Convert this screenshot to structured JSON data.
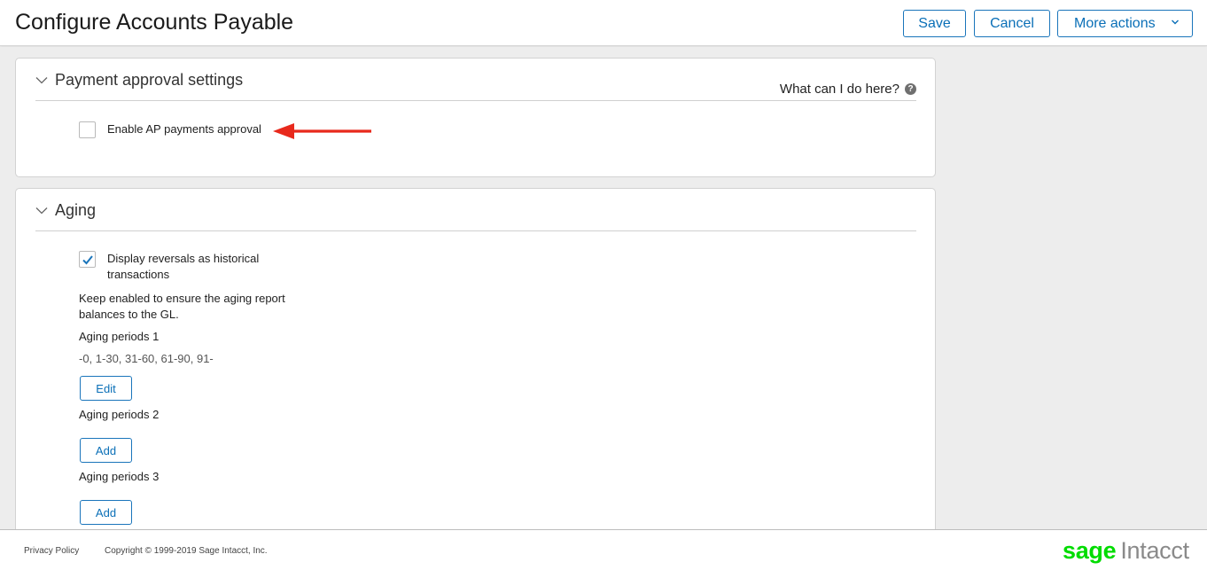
{
  "header": {
    "title": "Configure Accounts Payable",
    "save_label": "Save",
    "cancel_label": "Cancel",
    "more_actions_label": "More actions"
  },
  "payment_approval": {
    "title": "Payment approval settings",
    "help_text": "What can I do here?",
    "enable_ap_label": "Enable AP payments approval",
    "enable_ap_checked": false
  },
  "aging": {
    "title": "Aging",
    "display_reversals_label_line1": "Display reversals as historical",
    "display_reversals_label_line2": "transactions",
    "display_reversals_checked": true,
    "note_line1": "Keep enabled to ensure the aging report",
    "note_line2": "balances to the GL.",
    "periods": [
      {
        "label": "Aging periods 1",
        "value": "-0, 1-30, 31-60, 61-90, 91-",
        "button": "Edit"
      },
      {
        "label": "Aging periods 2",
        "value": "",
        "button": "Add"
      },
      {
        "label": "Aging periods 3",
        "value": "",
        "button": "Add"
      }
    ]
  },
  "footer": {
    "privacy": "Privacy Policy",
    "copyright": "Copyright © 1999-2019 Sage Intacct, Inc.",
    "logo_sage": "sage",
    "logo_intacct": "Intacct"
  },
  "colors": {
    "accent": "#0a6fb7",
    "annotation_arrow": "#e8291c",
    "logo_green": "#00dc00"
  },
  "icons": [
    "chevron-down-icon",
    "question-circle-icon",
    "checkmark-icon",
    "annotation-arrow-icon"
  ]
}
